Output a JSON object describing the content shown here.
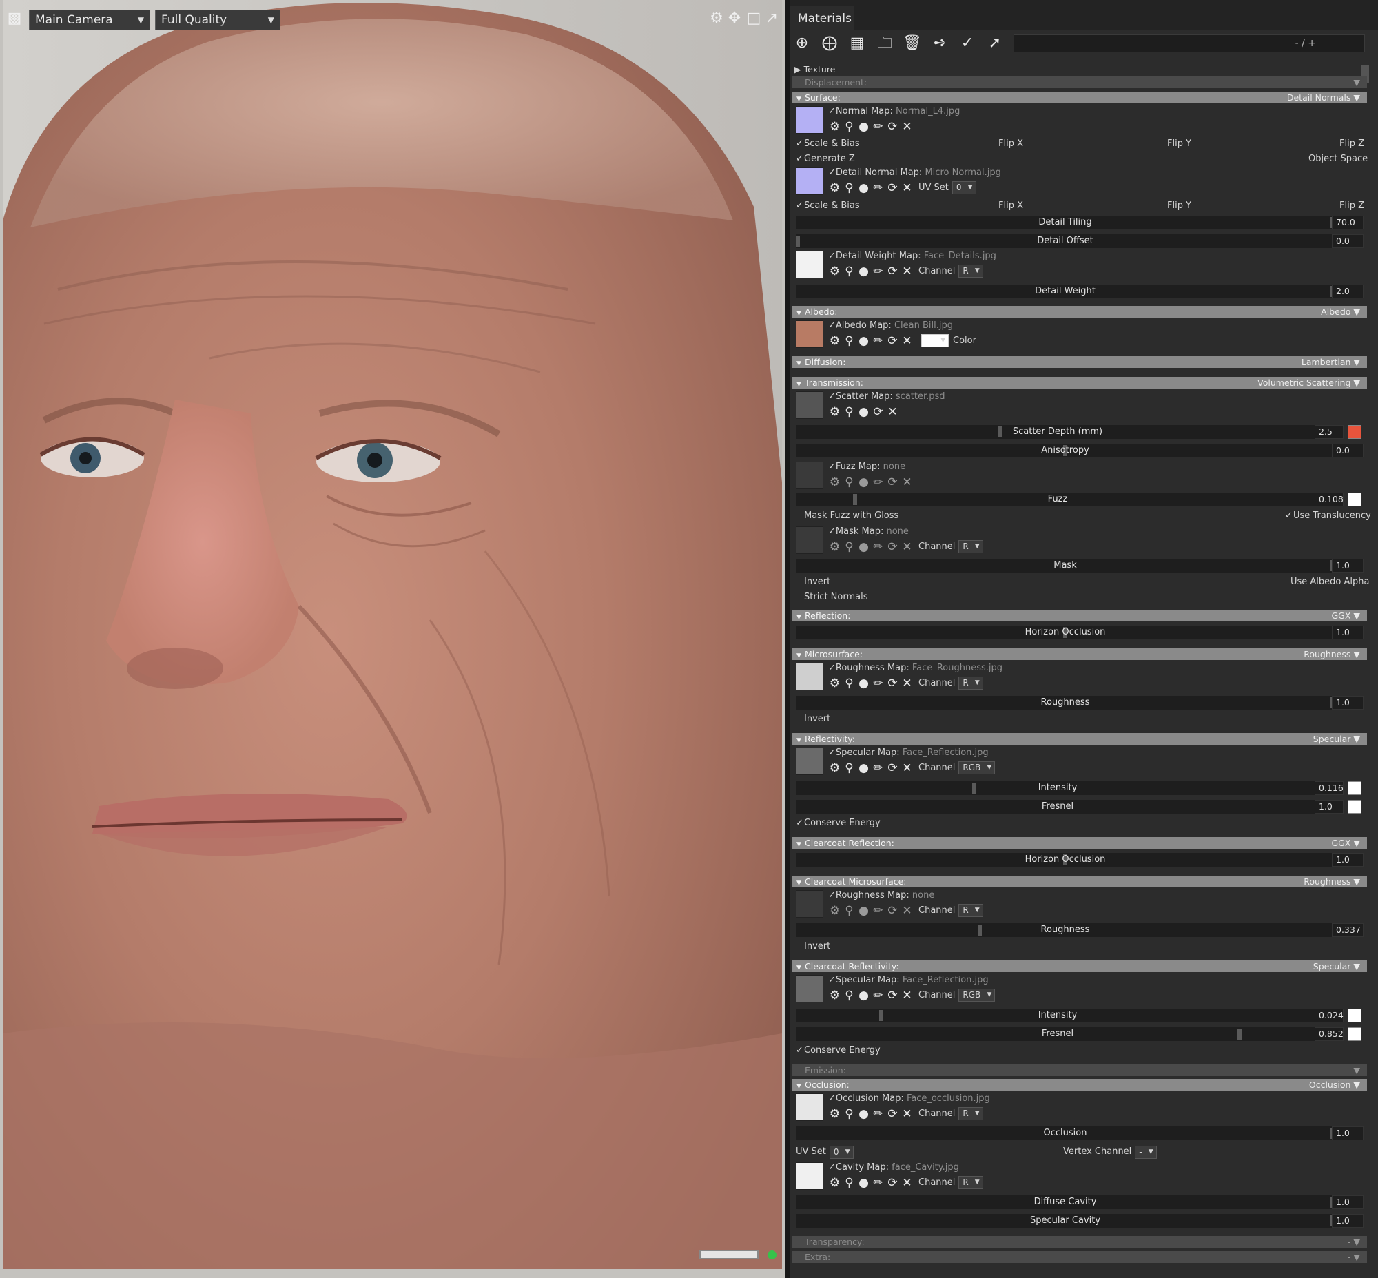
{
  "viewport": {
    "camera": "Main Camera",
    "quality": "Full Quality"
  },
  "panel": {
    "tab": "Materials",
    "search_value": "- / +"
  },
  "sections": {
    "texture": "Texture",
    "displacement": {
      "label": "Displacement:",
      "value": "-"
    },
    "surface": {
      "label": "Surface:",
      "value": "Detail Normals"
    },
    "albedo": {
      "label": "Albedo:",
      "value": "Albedo"
    },
    "diffusion": {
      "label": "Diffusion:",
      "value": "Lambertian"
    },
    "transmission": {
      "label": "Transmission:",
      "value": "Volumetric Scattering"
    },
    "reflection": {
      "label": "Reflection:",
      "value": "GGX"
    },
    "microsurface": {
      "label": "Microsurface:",
      "value": "Roughness"
    },
    "reflectivity": {
      "label": "Reflectivity:",
      "value": "Specular"
    },
    "cc_reflection": {
      "label": "Clearcoat Reflection:",
      "value": "GGX"
    },
    "cc_microsurface": {
      "label": "Clearcoat Microsurface:",
      "value": "Roughness"
    },
    "cc_reflectivity": {
      "label": "Clearcoat Reflectivity:",
      "value": "Specular"
    },
    "emission": {
      "label": "Emission:",
      "value": "-"
    },
    "occlusion": {
      "label": "Occlusion:",
      "value": "Occlusion"
    },
    "transparency": {
      "label": "Transparency:",
      "value": "-"
    },
    "extra": {
      "label": "Extra:",
      "value": "-"
    }
  },
  "maps": {
    "normal": {
      "label": "Normal Map:",
      "file": "Normal_L4.jpg"
    },
    "detail_normal": {
      "label": "Detail Normal Map:",
      "file": "Micro Normal.jpg"
    },
    "detail_weight": {
      "label": "Detail Weight Map:",
      "file": "Face_Details.jpg"
    },
    "albedo": {
      "label": "Albedo Map:",
      "file": "Clean Bill.jpg"
    },
    "scatter": {
      "label": "Scatter Map:",
      "file": "scatter.psd"
    },
    "fuzz": {
      "label": "Fuzz Map:",
      "file": "none"
    },
    "mask": {
      "label": "Mask Map:",
      "file": "none"
    },
    "roughness": {
      "label": "Roughness Map:",
      "file": "Face_Roughness.jpg"
    },
    "specular": {
      "label": "Specular Map:",
      "file": "Face_Reflection.jpg"
    },
    "cc_roughness": {
      "label": "Roughness Map:",
      "file": "none"
    },
    "cc_specular": {
      "label": "Specular Map:",
      "file": "Face_Reflection.jpg"
    },
    "occlusion": {
      "label": "Occlusion Map:",
      "file": "Face_occlusion.jpg"
    },
    "cavity": {
      "label": "Cavity Map:",
      "file": "face_Cavity.jpg"
    }
  },
  "labels": {
    "scale_bias": "Scale & Bias",
    "flip_x": "Flip X",
    "flip_y": "Flip Y",
    "flip_z": "Flip Z",
    "generate_z": "Generate Z",
    "object_space": "Object Space",
    "uv_set": "UV Set",
    "channel": "Channel",
    "color": "Color",
    "mask_fuzz_gloss": "Mask Fuzz with Gloss",
    "use_translucency": "Use Translucency",
    "invert": "Invert",
    "use_albedo_alpha": "Use Albedo Alpha",
    "strict_normals": "Strict Normals",
    "conserve_energy": "Conserve Energy",
    "vertex_channel": "Vertex Channel"
  },
  "dropdowns": {
    "uv_set_detail": "0",
    "channel_r": "R",
    "channel_rgb": "RGB",
    "uv_set_occ": "0",
    "vertex_channel": "-"
  },
  "sliders": {
    "detail_tiling": {
      "label": "Detail Tiling",
      "value": "70.0",
      "level": 1.0
    },
    "detail_offset": {
      "label": "Detail Offset",
      "value": "0.0",
      "level": 0.0
    },
    "detail_weight": {
      "label": "Detail Weight",
      "value": "2.0",
      "level": 1.0
    },
    "scatter_depth": {
      "label": "Scatter Depth (mm)",
      "value": "2.5",
      "level": 0.39
    },
    "anisotropy": {
      "label": "Anisotropy",
      "value": "0.0",
      "level": 0.5
    },
    "fuzz": {
      "label": "Fuzz",
      "value": "0.108",
      "level": 0.11
    },
    "mask": {
      "label": "Mask",
      "value": "1.0",
      "level": 1.0
    },
    "horizon_occlusion": {
      "label": "Horizon Occlusion",
      "value": "1.0",
      "level": 0.5
    },
    "roughness": {
      "label": "Roughness",
      "value": "1.0",
      "level": 1.0
    },
    "intensity": {
      "label": "Intensity",
      "value": "0.116",
      "level": 0.34
    },
    "fresnel": {
      "label": "Fresnel",
      "value": "1.0",
      "level": 1.0
    },
    "cc_horizon_occlusion": {
      "label": "Horizon Occlusion",
      "value": "1.0",
      "level": 0.5
    },
    "cc_roughness": {
      "label": "Roughness",
      "value": "0.337",
      "level": 0.34
    },
    "cc_intensity": {
      "label": "Intensity",
      "value": "0.024",
      "level": 0.16
    },
    "cc_fresnel": {
      "label": "Fresnel",
      "value": "0.852",
      "level": 0.85
    },
    "occlusion": {
      "label": "Occlusion",
      "value": "1.0",
      "level": 1.0
    },
    "diffuse_cavity": {
      "label": "Diffuse Cavity",
      "value": "1.0",
      "level": 1.0
    },
    "specular_cavity": {
      "label": "Specular Cavity",
      "value": "1.0",
      "level": 1.0
    }
  },
  "colors": {
    "scatter_swatch": "#e8543c",
    "white_swatch": "#ffffff",
    "albedo_color": "#ffffff",
    "normal_thumb": "#b4b0f4",
    "status_green": "#36c24a"
  },
  "icons": {
    "map_row": [
      "gear-icon",
      "magnifier-icon",
      "dropper-icon",
      "brush-icon",
      "refresh-icon",
      "close-icon"
    ]
  }
}
